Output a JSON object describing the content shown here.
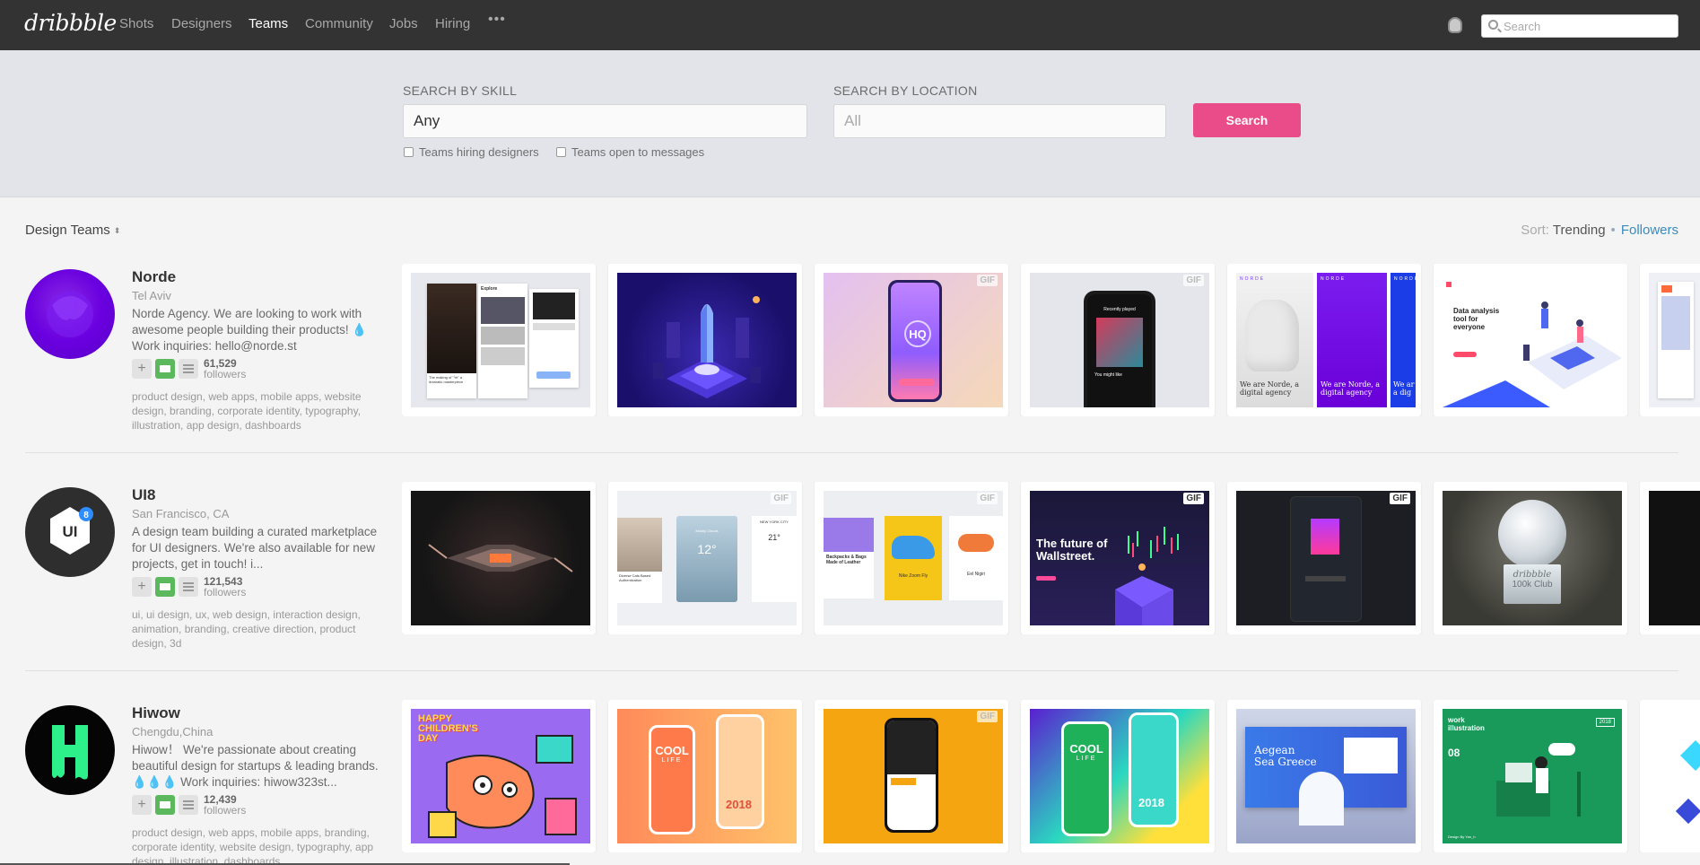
{
  "nav": {
    "logo": "dribbble",
    "links": [
      "Shots",
      "Designers",
      "Teams",
      "Community",
      "Jobs",
      "Hiring"
    ],
    "active": "Teams",
    "more": "•••",
    "search_placeholder": "Search"
  },
  "filters": {
    "skill_label": "SEARCH BY SKILL",
    "skill_value": "Any",
    "location_label": "SEARCH BY LOCATION",
    "location_placeholder": "All",
    "search_button": "Search",
    "check_hiring": "Teams hiring designers",
    "check_messages": "Teams open to messages"
  },
  "list": {
    "heading": "Design Teams",
    "sort_label": "Sort:",
    "sort_trending": "Trending",
    "sort_followers": "Followers"
  },
  "teams": [
    {
      "name": "Norde",
      "location": "Tel Aviv",
      "bio": "Norde Agency. We are looking to work with awesome people building their products! 💧 Work inquiries: hello@norde.st",
      "followers": "61,529",
      "followers_label": "followers",
      "tags": "product design, web apps, mobile apps, website design, branding, corporate identity, typography, illustration, app design, dashboards"
    },
    {
      "name": "UI8",
      "location": "San Francisco, CA",
      "bio": "A design team building a curated marketplace for UI designers. We're also available for new projects, get in touch! i...",
      "followers": "121,543",
      "followers_label": "followers",
      "tags": "ui, ui design, ux, web design, interaction design, animation, branding, creative direction, product design, 3d"
    },
    {
      "name": "Hiwow",
      "location": "Chengdu,China",
      "bio": "Hiwow！ We're passionate about creating beautiful design for startups & leading brands. 💧💧💧 Work inquiries: hiwow323st...",
      "followers": "12,439",
      "followers_label": "followers",
      "tags": "product design, web apps, mobile apps, branding, corporate identity, website design, typography, app design, illustration, dashboards"
    }
  ],
  "shot_text": {
    "n1_kanye": "The making of \"Ye\" a dramatic masterpiece",
    "n1_explore": "Explore",
    "n4_recent": "Recently played",
    "n4_might": "You might like",
    "n5_brand": "NORDE",
    "n5_tag1": "We are Norde, a digital agency",
    "n5_tag2": "We are Norde, a digital agency",
    "n5_tag3": "We ar a dig",
    "n6_title": "Data analysis tool for everyone",
    "n3_logo": "HQ",
    "u2_city": "Mostly Clouds",
    "u2_temp": "12°",
    "u2_city2": "NEW YORK CITY",
    "u2_temp2": "21°",
    "u2_caption": "Diverse Cats Based Authentication",
    "u3_cat": "Backpacks & Bags Made of Leather",
    "u3_shoe": "Nike Zoom Fly",
    "u3_food": "Eel Nigiri",
    "u4_title": "The future of Wallstreet.",
    "u6_logo": "dribbble",
    "u6_club": "100k Club",
    "h1_title": "HAPPY CHILDREN'S DAY",
    "h2_cool": "COOL",
    "h2_life": "LIFE",
    "h2_year": "2018",
    "h5_title": "Aegean Sea Greece",
    "h6_title": "work illustration",
    "h6_num": "08",
    "h6_year": "2018",
    "h6_footer": "Design By Yan_h",
    "gif": "GIF"
  },
  "colors": {
    "nav_bg": "#333333",
    "accent": "#ea4c89",
    "link_blue": "#3a8bbb",
    "message_green": "#5cb85c"
  }
}
